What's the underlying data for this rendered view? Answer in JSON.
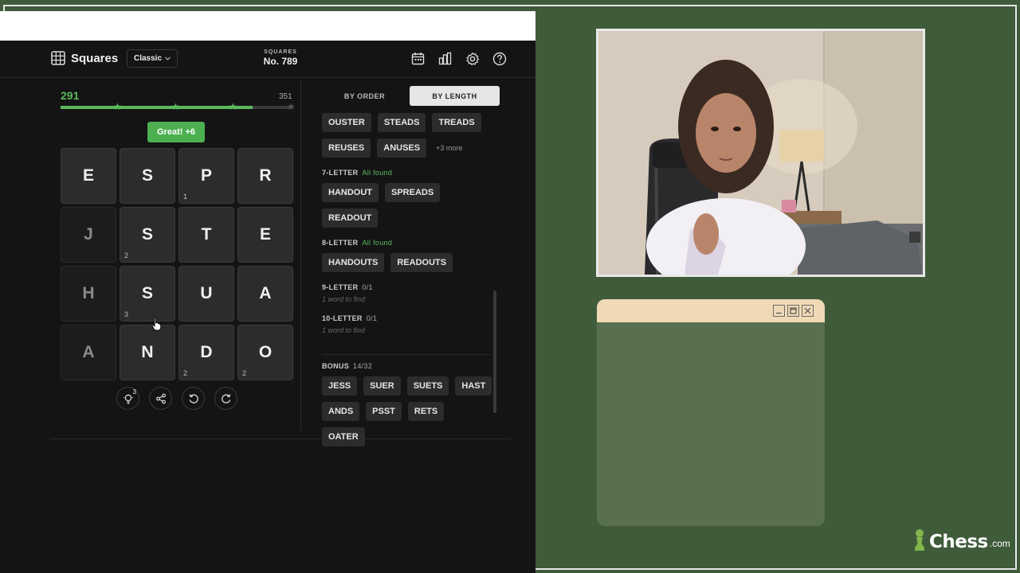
{
  "header": {
    "app_title": "Squares",
    "mode": "Classic",
    "puzzle_label": "SQUARES",
    "puzzle_number": "No. 789",
    "icons": [
      "calendar-icon",
      "stats-icon",
      "settings-icon",
      "help-icon"
    ]
  },
  "score": {
    "current": "291",
    "max": "351",
    "progress_fraction": 0.83
  },
  "toast": "Great! +6",
  "grid": [
    {
      "letter": "E",
      "count": "",
      "dim": false
    },
    {
      "letter": "S",
      "count": "",
      "dim": false
    },
    {
      "letter": "P",
      "count": "1",
      "dim": false
    },
    {
      "letter": "R",
      "count": "",
      "dim": false
    },
    {
      "letter": "J",
      "count": "",
      "dim": true
    },
    {
      "letter": "S",
      "count": "2",
      "dim": false
    },
    {
      "letter": "T",
      "count": "",
      "dim": false
    },
    {
      "letter": "E",
      "count": "",
      "dim": false
    },
    {
      "letter": "H",
      "count": "",
      "dim": true
    },
    {
      "letter": "S",
      "count": "3",
      "dim": false
    },
    {
      "letter": "U",
      "count": "",
      "dim": false
    },
    {
      "letter": "A",
      "count": "",
      "dim": false
    },
    {
      "letter": "A",
      "count": "",
      "dim": true
    },
    {
      "letter": "N",
      "count": "",
      "dim": false
    },
    {
      "letter": "D",
      "count": "2",
      "dim": false
    },
    {
      "letter": "O",
      "count": "2",
      "dim": false
    }
  ],
  "tools": {
    "hint_count": "3"
  },
  "tabs": {
    "by_order": "BY ORDER",
    "by_length": "BY LENGTH"
  },
  "words": {
    "six_row1": [
      "OUSTER",
      "STEADS",
      "TREADS"
    ],
    "six_row2": [
      "REUSES",
      "ANUSES"
    ],
    "six_more": "+3 more",
    "seven": {
      "label": "7-LETTER",
      "status": "All found",
      "words": [
        "HANDOUT",
        "SPREADS",
        "READOUT"
      ]
    },
    "eight": {
      "label": "8-LETTER",
      "status": "All found",
      "words": [
        "HANDOUTS",
        "READOUTS"
      ]
    },
    "nine": {
      "label": "9-LETTER",
      "status": "0/1",
      "hint": "1 word to find"
    },
    "ten": {
      "label": "10-LETTER",
      "status": "0/1",
      "hint": "1 word to find"
    }
  },
  "bonus": {
    "label": "BONUS",
    "status": "14/32",
    "words": [
      "JESS",
      "SUER",
      "SUETS",
      "HAST",
      "ANDS",
      "PSST",
      "RETS",
      "OATER"
    ]
  },
  "brand": {
    "name": "Chess",
    "tld": ".com"
  },
  "colors": {
    "background": "#3f5b3a",
    "accent_green": "#5cb85c",
    "window_bar": "#f0d9b5"
  }
}
